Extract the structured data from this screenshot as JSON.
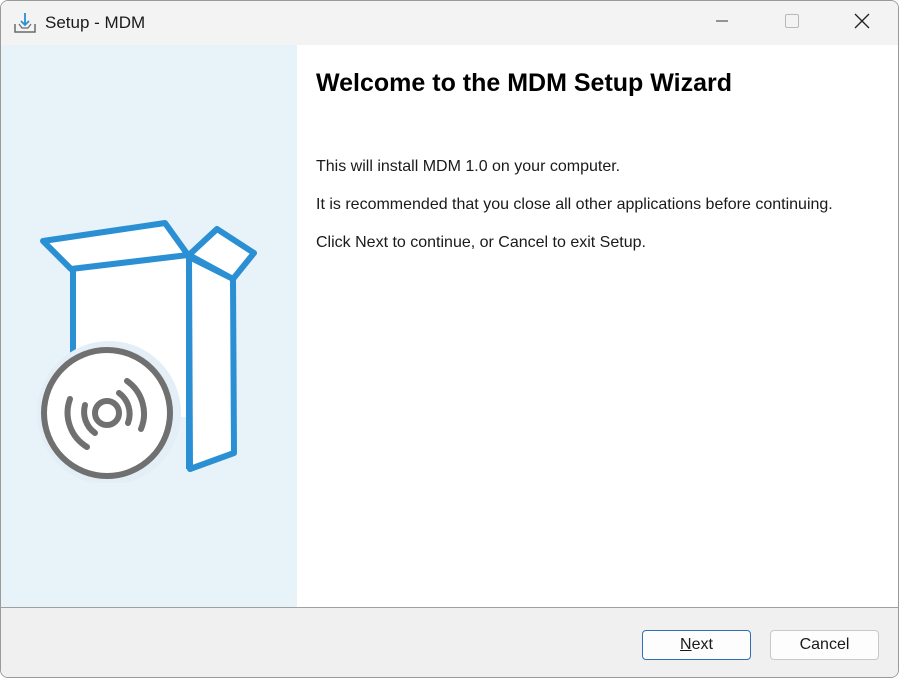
{
  "window": {
    "title": "Setup - MDM",
    "app_icon": "installer-download-icon",
    "controls": [
      "minimize-icon",
      "maximize-icon",
      "close-icon"
    ]
  },
  "illustration": {
    "icon": "software-box-with-disc-icon",
    "colors": {
      "box": "#2b8fd3",
      "disc": "#707070",
      "panel_bg": "#e8f2f9"
    }
  },
  "content": {
    "heading": "Welcome to the MDM Setup Wizard",
    "paragraphs": [
      "This will install MDM 1.0 on your computer.",
      "It is recommended that you close all other applications before continuing.",
      "Click Next to continue, or Cancel to exit Setup."
    ]
  },
  "footer": {
    "next_accel": "N",
    "next_rest": "ext",
    "cancel_label": "Cancel",
    "accent_color": "#2f6fb3"
  }
}
